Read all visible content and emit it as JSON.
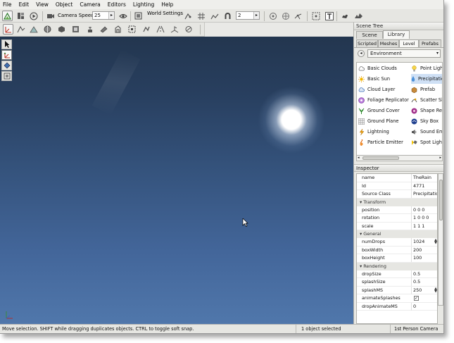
{
  "menu": [
    "File",
    "Edit",
    "View",
    "Object",
    "Camera",
    "Editors",
    "Lighting",
    "Help"
  ],
  "toolbar": {
    "camera_speed_label": "Camera Speed",
    "camera_speed_value": "25",
    "world_settings_label": "World Settings",
    "snap_value": "2"
  },
  "scene_tree": {
    "title": "Scene Tree",
    "tabs": [
      "Scene",
      "Library"
    ],
    "active_tab": "Library",
    "subtabs": [
      "Scripted",
      "Meshes",
      "Level",
      "Prefabs"
    ],
    "active_subtab": "Level",
    "category": "Environment",
    "items": [
      {
        "label": "Basic Clouds",
        "icon": "cloud-icon"
      },
      {
        "label": "Point Light",
        "icon": "bulb-icon"
      },
      {
        "label": "Basic Sun",
        "icon": "sun-icon"
      },
      {
        "label": "Precipitation",
        "icon": "raindrop-icon"
      },
      {
        "label": "Cloud Layer",
        "icon": "cloud-layer-icon"
      },
      {
        "label": "Prefab",
        "icon": "prefab-icon"
      },
      {
        "label": "Foliage Replicator",
        "icon": "foliage-icon"
      },
      {
        "label": "Scatter Sky",
        "icon": "scatter-sky-icon"
      },
      {
        "label": "Ground Cover",
        "icon": "ground-cover-icon"
      },
      {
        "label": "Shape Replicator",
        "icon": "shape-icon"
      },
      {
        "label": "Ground Plane",
        "icon": "ground-plane-icon"
      },
      {
        "label": "Sky Box",
        "icon": "skybox-icon"
      },
      {
        "label": "Lightning",
        "icon": "lightning-icon"
      },
      {
        "label": "Sound Emitter",
        "icon": "speaker-icon"
      },
      {
        "label": "Particle Emitter",
        "icon": "particle-icon"
      },
      {
        "label": "Spot Light",
        "icon": "spotlight-icon"
      }
    ]
  },
  "inspector": {
    "title": "Inspector",
    "top_rows": [
      {
        "key": "name",
        "value": "TheRain"
      },
      {
        "key": "Id",
        "value": "4771"
      },
      {
        "key": "Source Class",
        "value": "Precipitation"
      }
    ],
    "groups": [
      {
        "name": "Transform",
        "rows": [
          {
            "key": "position",
            "value": "0 0 0"
          },
          {
            "key": "rotation",
            "value": "1 0 0 0"
          },
          {
            "key": "scale",
            "value": "1 1 1"
          }
        ]
      },
      {
        "name": "General",
        "rows": [
          {
            "key": "numDrops",
            "value": "1024"
          },
          {
            "key": "boxWidth",
            "value": "200"
          },
          {
            "key": "boxHeight",
            "value": "100"
          }
        ]
      },
      {
        "name": "Rendering",
        "rows": [
          {
            "key": "dropSize",
            "value": "0.5"
          },
          {
            "key": "splashSize",
            "value": "0.5"
          },
          {
            "key": "splashMS",
            "value": "250"
          },
          {
            "key": "animateSplashes",
            "value": "✓"
          },
          {
            "key": "dropAnimateMS",
            "value": "0"
          }
        ]
      }
    ]
  },
  "status": {
    "hint": "Move selection.  SHIFT while dragging duplicates objects.  CTRL to toggle soft snap.",
    "selection": "1 object selected",
    "camera": "1st Person Camera"
  }
}
